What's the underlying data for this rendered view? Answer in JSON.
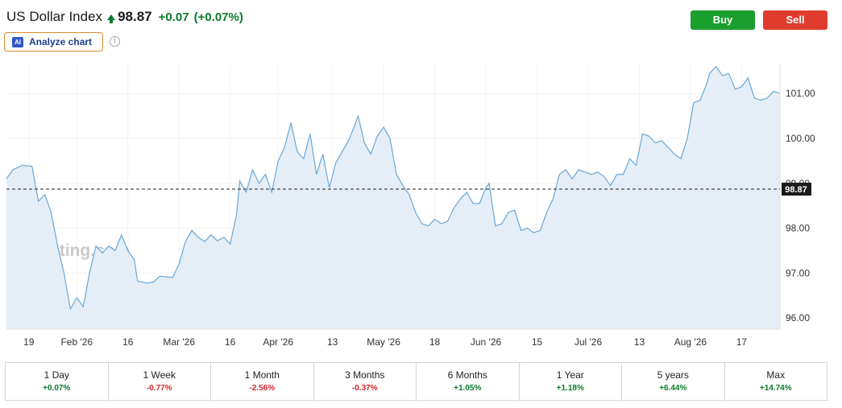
{
  "header": {
    "title": "US Dollar Index",
    "price": "98.87",
    "change": "+0.07",
    "change_pct": "(+0.07%)",
    "analyze_label": "Analyze chart",
    "ai_badge": "AI",
    "buy_label": "Buy",
    "sell_label": "Sell"
  },
  "colors": {
    "up": "#0a7b2c",
    "down": "#d0262b",
    "buy": "#1a9e2e",
    "sell": "#e03c2e",
    "line": "#6aa8d8",
    "area": "#e5eef6"
  },
  "chart_data": {
    "type": "area",
    "watermark": "Investing.com",
    "current_label": "98.87",
    "current_value": 98.87,
    "ylim": [
      95.75,
      101.65
    ],
    "yticks": [
      96.0,
      97.0,
      98.0,
      99.0,
      100.0,
      101.0
    ],
    "ytick_labels": [
      "96.00",
      "97.00",
      "98.00",
      "99.00",
      "100.00",
      "101.00"
    ],
    "xtick_labels": [
      "19",
      "Feb '26",
      "16",
      "Mar '26",
      "16",
      "Apr '26",
      "13",
      "May '26",
      "18",
      "Jun '26",
      "15",
      "Jul '26",
      "13",
      "Aug '26",
      "17"
    ],
    "xtick_index": [
      7,
      22,
      38,
      54,
      70,
      85,
      102,
      118,
      134,
      150,
      166,
      182,
      198,
      214,
      230
    ],
    "x_count": 243,
    "series": [
      {
        "values": [
          [
            0,
            99.1
          ],
          [
            2,
            99.3
          ],
          [
            5,
            99.4
          ],
          [
            8,
            99.38
          ],
          [
            10,
            98.6
          ],
          [
            12,
            98.75
          ],
          [
            14,
            98.35
          ],
          [
            16,
            97.6
          ],
          [
            18,
            97.0
          ],
          [
            20,
            96.2
          ],
          [
            22,
            96.45
          ],
          [
            24,
            96.25
          ],
          [
            26,
            97.0
          ],
          [
            28,
            97.6
          ],
          [
            30,
            97.45
          ],
          [
            32,
            97.6
          ],
          [
            34,
            97.5
          ],
          [
            36,
            97.85
          ],
          [
            38,
            97.5
          ],
          [
            40,
            97.3
          ],
          [
            41,
            96.82
          ],
          [
            44,
            96.78
          ],
          [
            46,
            96.8
          ],
          [
            48,
            96.93
          ],
          [
            52,
            96.9
          ],
          [
            54,
            97.2
          ],
          [
            56,
            97.7
          ],
          [
            58,
            97.95
          ],
          [
            60,
            97.8
          ],
          [
            62,
            97.7
          ],
          [
            64,
            97.85
          ],
          [
            66,
            97.72
          ],
          [
            68,
            97.8
          ],
          [
            70,
            97.65
          ],
          [
            72,
            98.3
          ],
          [
            73,
            99.05
          ],
          [
            75,
            98.8
          ],
          [
            77,
            99.3
          ],
          [
            79,
            99.0
          ],
          [
            81,
            99.2
          ],
          [
            83,
            98.8
          ],
          [
            85,
            99.5
          ],
          [
            87,
            99.8
          ],
          [
            89,
            100.35
          ],
          [
            91,
            99.7
          ],
          [
            93,
            99.55
          ],
          [
            95,
            100.1
          ],
          [
            97,
            99.2
          ],
          [
            99,
            99.65
          ],
          [
            101,
            98.9
          ],
          [
            103,
            99.45
          ],
          [
            105,
            99.7
          ],
          [
            107,
            99.95
          ],
          [
            109,
            100.3
          ],
          [
            110,
            100.5
          ],
          [
            112,
            99.9
          ],
          [
            114,
            99.65
          ],
          [
            116,
            100.05
          ],
          [
            118,
            100.25
          ],
          [
            120,
            100.0
          ],
          [
            122,
            99.2
          ],
          [
            124,
            98.95
          ],
          [
            126,
            98.75
          ],
          [
            128,
            98.35
          ],
          [
            130,
            98.1
          ],
          [
            132,
            98.05
          ],
          [
            134,
            98.2
          ],
          [
            136,
            98.1
          ],
          [
            138,
            98.15
          ],
          [
            140,
            98.45
          ],
          [
            142,
            98.65
          ],
          [
            144,
            98.8
          ],
          [
            146,
            98.55
          ],
          [
            148,
            98.55
          ],
          [
            150,
            98.9
          ],
          [
            151,
            99.0
          ],
          [
            153,
            98.05
          ],
          [
            155,
            98.1
          ],
          [
            157,
            98.35
          ],
          [
            159,
            98.4
          ],
          [
            161,
            97.95
          ],
          [
            163,
            98.0
          ],
          [
            165,
            97.9
          ],
          [
            167,
            97.95
          ],
          [
            169,
            98.35
          ],
          [
            171,
            98.65
          ],
          [
            173,
            99.2
          ],
          [
            175,
            99.3
          ],
          [
            177,
            99.1
          ],
          [
            179,
            99.3
          ],
          [
            181,
            99.25
          ],
          [
            183,
            99.2
          ],
          [
            185,
            99.25
          ],
          [
            187,
            99.15
          ],
          [
            189,
            98.95
          ],
          [
            191,
            99.2
          ],
          [
            193,
            99.2
          ],
          [
            195,
            99.55
          ],
          [
            197,
            99.4
          ],
          [
            199,
            100.1
          ],
          [
            201,
            100.05
          ],
          [
            203,
            99.9
          ],
          [
            205,
            99.95
          ],
          [
            207,
            99.8
          ],
          [
            209,
            99.65
          ],
          [
            211,
            99.55
          ],
          [
            213,
            100.0
          ],
          [
            215,
            100.8
          ],
          [
            217,
            100.85
          ],
          [
            219,
            101.2
          ],
          [
            220,
            101.45
          ],
          [
            222,
            101.6
          ],
          [
            224,
            101.4
          ],
          [
            226,
            101.45
          ],
          [
            228,
            101.1
          ],
          [
            230,
            101.15
          ],
          [
            232,
            101.35
          ],
          [
            234,
            100.9
          ],
          [
            236,
            100.85
          ],
          [
            238,
            100.9
          ],
          [
            240,
            101.05
          ],
          [
            242,
            101.0
          ]
        ]
      }
    ]
  },
  "periods": [
    {
      "label": "1 Day",
      "change": "+0.07%",
      "dir": "pos"
    },
    {
      "label": "1 Week",
      "change": "-0.77%",
      "dir": "neg"
    },
    {
      "label": "1 Month",
      "change": "-2.56%",
      "dir": "neg"
    },
    {
      "label": "3 Months",
      "change": "-0.37%",
      "dir": "neg"
    },
    {
      "label": "6 Months",
      "change": "+1.05%",
      "dir": "pos"
    },
    {
      "label": "1 Year",
      "change": "+1.18%",
      "dir": "pos"
    },
    {
      "label": "5 years",
      "change": "+6.44%",
      "dir": "pos"
    },
    {
      "label": "Max",
      "change": "+14.74%",
      "dir": "pos"
    }
  ]
}
